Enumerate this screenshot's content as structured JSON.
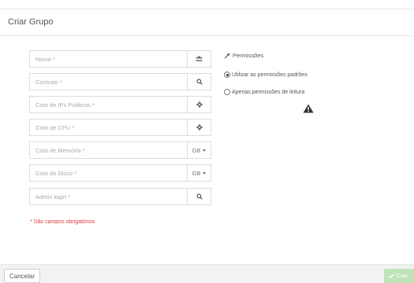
{
  "dialog": {
    "title": "Criar Grupo"
  },
  "form": {
    "name": {
      "placeholder": "Nome *",
      "icon": "users-icon"
    },
    "contract": {
      "placeholder": "Contrato *",
      "icon": "search-icon"
    },
    "public_ips": {
      "placeholder": "Cota de IPs Públicos *",
      "icon": "gear-icon"
    },
    "cpu": {
      "placeholder": "Cota de CPU *",
      "icon": "gear-icon"
    },
    "memory": {
      "placeholder": "Cota de Memória *",
      "unit": "GB"
    },
    "disk": {
      "placeholder": "Cota do Disco *",
      "unit": "GB"
    },
    "admin_login": {
      "placeholder": "Admin login *",
      "icon": "search-icon"
    },
    "required_note": "* São campos obrigatórios"
  },
  "permissions": {
    "title": "Permissões",
    "options": [
      {
        "label": "Utilizar as permissões padrões",
        "checked": true
      },
      {
        "label": "Apenas permissões de leitura",
        "checked": false
      }
    ]
  },
  "footer": {
    "cancel_label": "Cancelar",
    "create_label": "Criar"
  },
  "colors": {
    "required_text": "#e23b3b",
    "create_button": "#bfe3b8",
    "footer_bg": "#f2f2f2"
  }
}
